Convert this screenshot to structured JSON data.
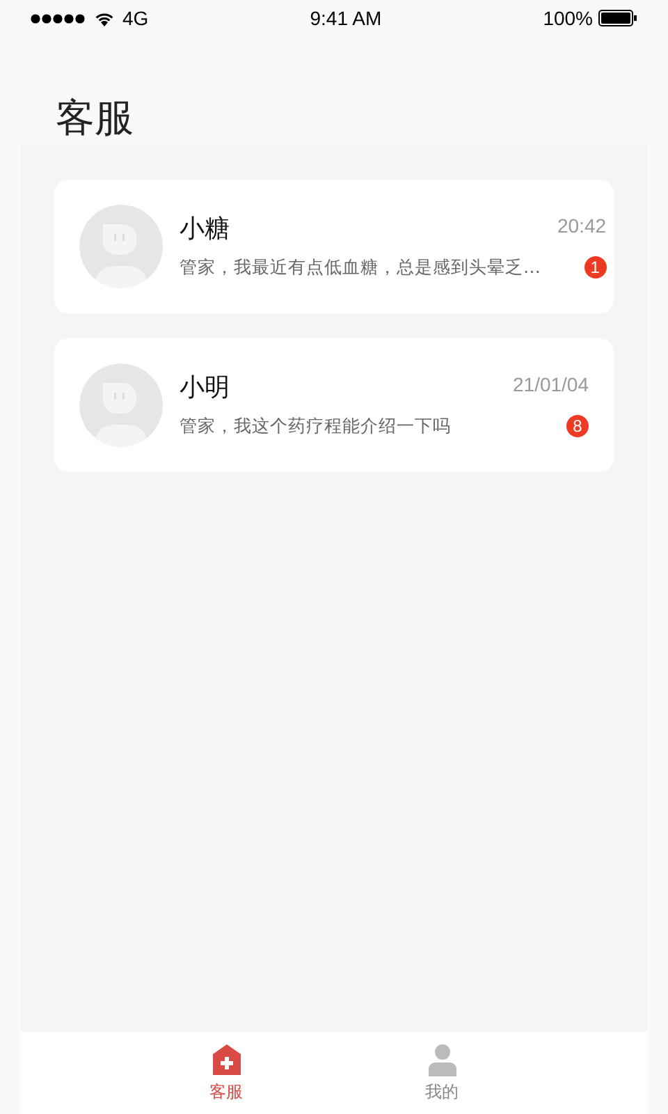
{
  "status_bar": {
    "carrier": "4G",
    "time": "9:41 AM",
    "battery": "100%"
  },
  "title": "客服",
  "conversations": [
    {
      "name": "小糖",
      "time": "20:42",
      "preview": "管家，我最近有点低血糖，总是感到头晕乏…",
      "unread": "1"
    },
    {
      "name": "小明",
      "time": "21/01/04",
      "preview": "管家，我这个药疗程能介绍一下吗",
      "unread": "8"
    }
  ],
  "tabs": [
    {
      "label": "客服",
      "kind": "service",
      "selected": true
    },
    {
      "label": "我的",
      "kind": "profile",
      "selected": false
    }
  ]
}
